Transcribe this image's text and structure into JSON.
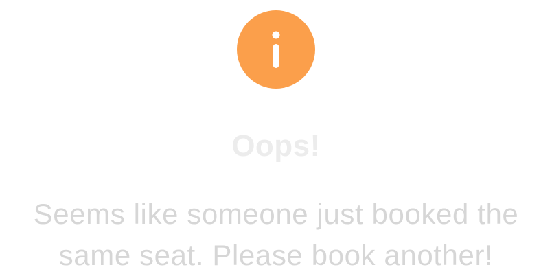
{
  "dialog": {
    "icon": "info-icon",
    "icon_color": "#fb9f4b",
    "title": "Oops!",
    "title_color": "#ececec",
    "message": "Seems like someone just booked the same seat. Please book another!",
    "message_color": "#d6d6d6"
  }
}
